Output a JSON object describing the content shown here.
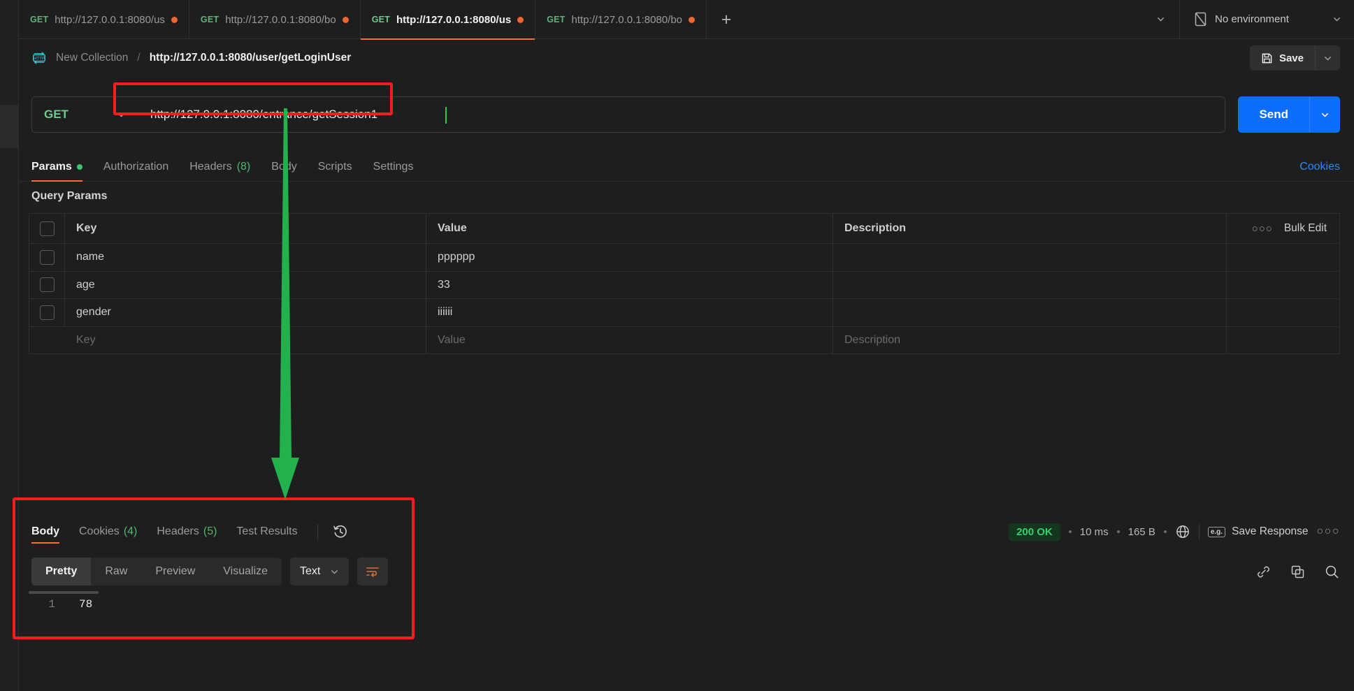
{
  "tabstrip": {
    "tabs": [
      {
        "method": "GET",
        "name": "http://127.0.0.1:8080/us",
        "unsaved": true,
        "active": false
      },
      {
        "method": "GET",
        "name": "http://127.0.0.1:8080/bo",
        "unsaved": true,
        "active": false
      },
      {
        "method": "GET",
        "name": "http://127.0.0.1:8080/us",
        "unsaved": true,
        "active": true
      },
      {
        "method": "GET",
        "name": "http://127.0.0.1:8080/bo",
        "unsaved": true,
        "active": false
      }
    ],
    "new_tab_label": "+",
    "environment": "No environment",
    "icons": {
      "tab_list": "chevron-down-icon",
      "env": "environment-icon",
      "env_caret": "chevron-down-icon"
    }
  },
  "breadcrumb": {
    "icon": "http-protocol-icon",
    "collection": "New Collection",
    "separator": "/",
    "current": "http://127.0.0.1:8080/user/getLoginUser",
    "save_label": "Save",
    "save_icon": "floppy-disk-icon"
  },
  "url_bar": {
    "method": "GET",
    "url": "http://127.0.0.1:8080/entrance/getSession1",
    "send_label": "Send"
  },
  "request_tabs": {
    "items": [
      {
        "label": "Params",
        "badge": "",
        "dot": true,
        "active": true
      },
      {
        "label": "Authorization",
        "badge": "",
        "dot": false,
        "active": false
      },
      {
        "label": "Headers",
        "badge": "(8)",
        "dot": false,
        "active": false
      },
      {
        "label": "Body",
        "badge": "",
        "dot": false,
        "active": false
      },
      {
        "label": "Scripts",
        "badge": "",
        "dot": false,
        "active": false
      },
      {
        "label": "Settings",
        "badge": "",
        "dot": false,
        "active": false
      }
    ],
    "cookies_link": "Cookies"
  },
  "query_params": {
    "title": "Query Params",
    "headers": {
      "key": "Key",
      "value": "Value",
      "description": "Description"
    },
    "bulk_edit_label": "Bulk Edit",
    "bulk_dots": "○○○",
    "rows": [
      {
        "key": "name",
        "value": "pppppp",
        "description": ""
      },
      {
        "key": "age",
        "value": "33",
        "description": ""
      },
      {
        "key": "gender",
        "value": "iiiiii",
        "description": ""
      }
    ],
    "placeholder_row": {
      "key": "Key",
      "value": "Value",
      "description": "Description"
    }
  },
  "response": {
    "tabs": [
      {
        "label": "Body",
        "badge": "",
        "active": true
      },
      {
        "label": "Cookies",
        "badge": "(4)",
        "active": false
      },
      {
        "label": "Headers",
        "badge": "(5)",
        "active": false
      },
      {
        "label": "Test Results",
        "badge": "",
        "active": false
      }
    ],
    "history_icon": "clock-history-icon",
    "status": "200 OK",
    "time": "10 ms",
    "size": "165 B",
    "globe_icon": "globe-icon",
    "save_response_label": "Save Response",
    "save_response_icon": "example-eg-icon",
    "more_icon": "○○○",
    "view_modes": [
      {
        "label": "Pretty",
        "active": true
      },
      {
        "label": "Raw",
        "active": false
      },
      {
        "label": "Preview",
        "active": false
      },
      {
        "label": "Visualize",
        "active": false
      }
    ],
    "format": "Text",
    "wrap_icon": "word-wrap-icon",
    "right_icons": [
      "link-icon",
      "copy-icon",
      "search-icon"
    ],
    "body_lines": [
      {
        "number": "1",
        "text": "78"
      }
    ]
  },
  "colors": {
    "accent_orange": "#f2703a",
    "send_blue": "#0d6efd",
    "status_green": "#3ecb6e",
    "method_green": "#6dcb8b",
    "annotation_red": "#f51d1d",
    "annotation_arrow_green": "#22b14c"
  }
}
